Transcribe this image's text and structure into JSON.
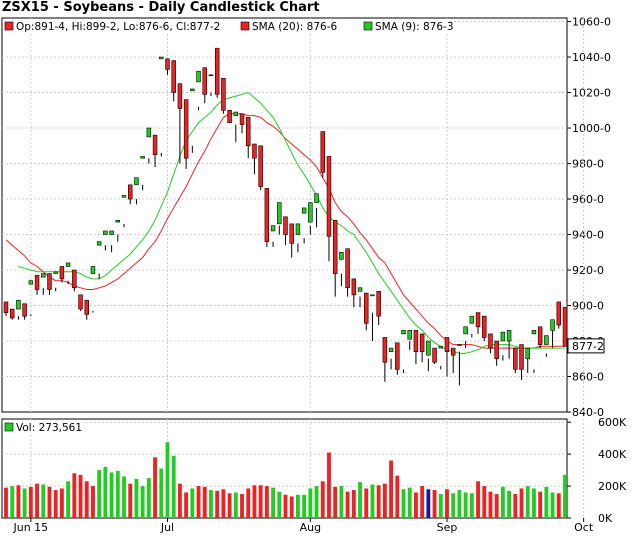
{
  "chart_title": "ZSX15 - Soybeans - Daily Candlestick Chart",
  "colors": {
    "up": "#22cc22",
    "down": "#ee2222",
    "sma20": "#ee2222",
    "sma9": "#22cc22",
    "grid": "#cccccc",
    "volume_blue": "#1a1a99"
  },
  "legend": {
    "ohlc": "Op:891-4, Hi:899-2, Lo:876-6, Cl:877-2",
    "sma20": "SMA (20): 876-6",
    "sma9": "SMA (9): 876-3",
    "volume": "Vol: 273,561"
  },
  "last_price_label": "877-2",
  "chart_data": [
    {
      "type": "candlestick",
      "title": "ZSX15 - Soybeans - Daily Candlestick Chart",
      "y_ticks": [
        "1060-0",
        "1040-0",
        "1020-0",
        "1000-0",
        "980-0",
        "960-0",
        "940-0",
        "920-0",
        "900-0",
        "880-0",
        "860-0",
        "840-0"
      ],
      "y_tick_values": [
        1060,
        1040,
        1020,
        1000,
        980,
        960,
        940,
        920,
        900,
        880,
        860,
        840
      ],
      "ylim": [
        840,
        1062
      ],
      "x_ticks": [
        "Jun 15",
        "Jul",
        "Aug",
        "Sep",
        "Oct"
      ],
      "x_tick_index": [
        4,
        26,
        49,
        71,
        93
      ],
      "grid": true,
      "candles": [
        [
          899,
          902,
          896,
          894,
          "down"
        ],
        [
          896,
          898,
          893,
          892,
          "down"
        ],
        [
          894,
          903,
          898,
          892,
          "up"
        ],
        [
          898,
          901,
          894,
          892,
          "down"
        ],
        [
          895,
          914,
          912,
          894,
          "up"
        ],
        [
          912,
          917,
          909,
          906,
          "down"
        ],
        [
          910,
          918,
          916,
          906,
          "up"
        ],
        [
          916,
          918,
          909,
          906,
          "down"
        ],
        [
          910,
          919,
          918,
          908,
          "up"
        ],
        [
          918,
          922,
          915,
          913,
          "down"
        ],
        [
          914,
          924,
          922,
          912,
          "up"
        ],
        [
          918,
          920,
          910,
          908,
          "down"
        ],
        [
          903,
          906,
          898,
          897,
          "down"
        ],
        [
          900,
          903,
          895,
          892,
          "down"
        ],
        [
          897,
          922,
          918,
          896,
          "up"
        ],
        [
          918,
          936,
          934,
          915,
          "up"
        ],
        [
          934,
          942,
          940,
          931,
          "up"
        ],
        [
          934,
          942,
          940,
          930,
          "up"
        ],
        [
          940,
          948,
          947,
          936,
          "up"
        ],
        [
          946,
          962,
          961,
          944,
          "up"
        ],
        [
          962,
          968,
          960,
          957,
          "down"
        ],
        [
          960,
          972,
          968,
          957,
          "up"
        ],
        [
          968,
          984,
          983,
          965,
          "up"
        ],
        [
          983,
          1000,
          995,
          980,
          "up"
        ],
        [
          990,
          996,
          985,
          978,
          "down"
        ],
        [
          986,
          1040,
          1039,
          984,
          "up"
        ],
        [
          1036,
          1039,
          1033,
          1030,
          "down"
        ],
        [
          1034,
          1038,
          1020,
          1015,
          "down"
        ],
        [
          1020,
          1025,
          1011,
          980,
          "down"
        ],
        [
          1010,
          1016,
          983,
          977,
          "down"
        ],
        [
          990,
          1022,
          1021,
          986,
          "up"
        ],
        [
          1012,
          1032,
          1026,
          1010,
          "up"
        ],
        [
          1024,
          1034,
          1019,
          1014,
          "down"
        ],
        [
          1020,
          1030,
          1030,
          1018,
          "up"
        ],
        [
          1030,
          1045,
          1019,
          1017,
          "down"
        ],
        [
          1020,
          1028,
          1010,
          1008,
          "down"
        ],
        [
          1008,
          1010,
          1003,
          1003,
          "down"
        ],
        [
          1002,
          1009,
          1007,
          992,
          "up"
        ],
        [
          1007,
          1008,
          1002,
          997,
          "down"
        ],
        [
          1004,
          1006,
          990,
          983,
          "down"
        ],
        [
          990,
          991,
          983,
          974,
          "down"
        ],
        [
          983,
          990,
          967,
          965,
          "down"
        ],
        [
          964,
          966,
          936,
          933,
          "down"
        ],
        [
          936,
          942,
          945,
          933,
          "up"
        ],
        [
          945,
          958,
          946,
          940,
          "up"
        ],
        [
          946,
          950,
          940,
          934,
          "down"
        ],
        [
          940,
          946,
          935,
          927,
          "down"
        ],
        [
          935,
          946,
          940,
          930,
          "up"
        ],
        [
          938,
          955,
          952,
          935,
          "up"
        ],
        [
          945,
          958,
          947,
          940,
          "up"
        ],
        [
          955,
          963,
          958,
          944,
          "up"
        ],
        [
          994,
          998,
          975,
          972,
          "down"
        ],
        [
          974,
          984,
          939,
          925,
          "down"
        ],
        [
          940,
          948,
          918,
          905,
          "down"
        ],
        [
          918,
          930,
          926,
          911,
          "up"
        ],
        [
          926,
          932,
          910,
          905,
          "down"
        ],
        [
          911,
          915,
          906,
          899,
          "down"
        ],
        [
          905,
          910,
          908,
          899,
          "up"
        ],
        [
          904,
          907,
          890,
          886,
          "down"
        ],
        [
          896,
          906,
          906,
          880,
          "up"
        ],
        [
          904,
          908,
          894,
          889,
          "down"
        ],
        [
          878,
          882,
          868,
          857,
          "down"
        ],
        [
          870,
          876,
          874,
          864,
          "up"
        ],
        [
          874,
          879,
          864,
          861,
          "down"
        ],
        [
          864,
          886,
          884,
          862,
          "up"
        ],
        [
          880,
          886,
          881,
          875,
          "up"
        ],
        [
          880,
          886,
          874,
          867,
          "down"
        ],
        [
          878,
          884,
          874,
          868,
          "down"
        ],
        [
          870,
          880,
          872,
          863,
          "up"
        ],
        [
          874,
          876,
          868,
          867,
          "down"
        ],
        [
          866,
          877,
          876,
          864,
          "up"
        ],
        [
          876,
          882,
          874,
          860,
          "down"
        ],
        [
          872,
          876,
          872,
          862,
          "down"
        ],
        [
          874,
          878,
          878,
          855,
          "up"
        ],
        [
          880,
          888,
          884,
          876,
          "up"
        ],
        [
          884,
          894,
          890,
          882,
          "up"
        ],
        [
          892,
          896,
          888,
          884,
          "down"
        ],
        [
          889,
          894,
          882,
          880,
          "down"
        ],
        [
          879,
          884,
          876,
          873,
          "down"
        ],
        [
          876,
          880,
          870,
          866,
          "down"
        ],
        [
          872,
          885,
          880,
          869,
          "up"
        ],
        [
          880,
          886,
          880,
          870,
          "up"
        ],
        [
          872,
          876,
          864,
          862,
          "down"
        ],
        [
          866,
          878,
          864,
          858,
          "down"
        ],
        [
          870,
          876,
          870,
          862,
          "up"
        ],
        [
          864,
          884,
          886,
          862,
          "up"
        ],
        [
          886,
          888,
          878,
          876,
          "down"
        ],
        [
          873,
          883,
          878,
          871,
          "up"
        ],
        [
          886,
          892,
          886,
          876,
          "up"
        ],
        [
          892,
          902,
          889,
          887,
          "down"
        ],
        [
          891,
          899,
          877,
          877,
          "down"
        ]
      ],
      "sma20": [
        937,
        934,
        931,
        928,
        924,
        922,
        919,
        916,
        914,
        914,
        913,
        911,
        910,
        909,
        909,
        910,
        911,
        913,
        915,
        918,
        921,
        924,
        927,
        932,
        936,
        942,
        949,
        955,
        961,
        967,
        974,
        981,
        987,
        994,
        1000,
        1006,
        1008,
        1008,
        1008,
        1007,
        1007,
        1006,
        1003,
        1001,
        998,
        994,
        991,
        988,
        985,
        982,
        978,
        972,
        966,
        958,
        953,
        950,
        946,
        941,
        937,
        932,
        927,
        924,
        918,
        912,
        906,
        902,
        898,
        894,
        890,
        887,
        883,
        880,
        878,
        878,
        878,
        878,
        877,
        876,
        876,
        876,
        876,
        876,
        876,
        876,
        876,
        876,
        877,
        877,
        877,
        877,
        877
      ],
      "sma9": [
        922,
        921,
        920,
        919,
        919,
        919,
        919,
        919,
        919,
        919,
        918,
        916,
        915,
        915,
        917,
        920,
        923,
        926,
        929,
        933,
        937,
        942,
        948,
        956,
        964,
        974,
        984,
        993,
        998,
        1003,
        1006,
        1009,
        1013,
        1016,
        1017,
        1018,
        1019,
        1020,
        1017,
        1014,
        1010,
        1006,
        1000,
        993,
        986,
        979,
        974,
        968,
        962,
        955,
        950,
        947,
        945,
        942,
        940,
        935,
        930,
        924,
        918,
        913,
        908,
        903,
        898,
        893,
        889,
        886,
        882,
        879,
        877,
        875,
        874,
        873,
        873,
        874,
        875,
        877,
        878,
        878,
        878,
        878,
        877,
        876,
        876,
        876,
        876,
        876,
        876,
        876,
        876
      ],
      "volume_label": "Vol: 273,561",
      "volume_ticks": [
        "600K",
        "400K",
        "200K",
        "0K"
      ],
      "volume_tick_values": [
        600000,
        400000,
        200000,
        0
      ],
      "volume": [
        190000,
        200000,
        205000,
        185000,
        195000,
        215000,
        210000,
        195000,
        175000,
        185000,
        230000,
        280000,
        270000,
        230000,
        200000,
        300000,
        320000,
        285000,
        295000,
        260000,
        215000,
        245000,
        200000,
        250000,
        380000,
        310000,
        475000,
        390000,
        215000,
        160000,
        185000,
        200000,
        195000,
        175000,
        170000,
        180000,
        155000,
        160000,
        150000,
        185000,
        205000,
        205000,
        200000,
        190000,
        165000,
        145000,
        135000,
        145000,
        145000,
        185000,
        200000,
        230000,
        410000,
        195000,
        200000,
        165000,
        175000,
        225000,
        185000,
        210000,
        205000,
        215000,
        360000,
        265000,
        180000,
        190000,
        160000,
        200000,
        180000,
        175000,
        150000,
        180000,
        155000,
        175000,
        160000,
        155000,
        230000,
        200000,
        165000,
        150000,
        195000,
        170000,
        150000,
        185000,
        200000,
        185000,
        165000,
        195000,
        160000,
        155000,
        270000
      ],
      "volume_colors": [
        "down",
        "up",
        "down",
        "up",
        "down",
        "down",
        "up",
        "down",
        "down",
        "down",
        "up",
        "down",
        "down",
        "down",
        "down",
        "up",
        "up",
        "up",
        "up",
        "up",
        "down",
        "up",
        "up",
        "up",
        "down",
        "up",
        "up",
        "up",
        "down",
        "down",
        "up",
        "down",
        "down",
        "up",
        "down",
        "down",
        "down",
        "up",
        "down",
        "down",
        "down",
        "down",
        "down",
        "up",
        "up",
        "down",
        "down",
        "up",
        "up",
        "up",
        "up",
        "down",
        "down",
        "down",
        "up",
        "down",
        "down",
        "up",
        "down",
        "up",
        "down",
        "down",
        "down",
        "down",
        "up",
        "up",
        "down",
        "down",
        "blue",
        "down",
        "up",
        "down",
        "up",
        "up",
        "up",
        "up",
        "down",
        "down",
        "down",
        "down",
        "up",
        "up",
        "down",
        "down",
        "up",
        "up",
        "down",
        "up",
        "up",
        "down",
        "up"
      ],
      "volume_ylim": [
        0,
        620000
      ]
    }
  ]
}
